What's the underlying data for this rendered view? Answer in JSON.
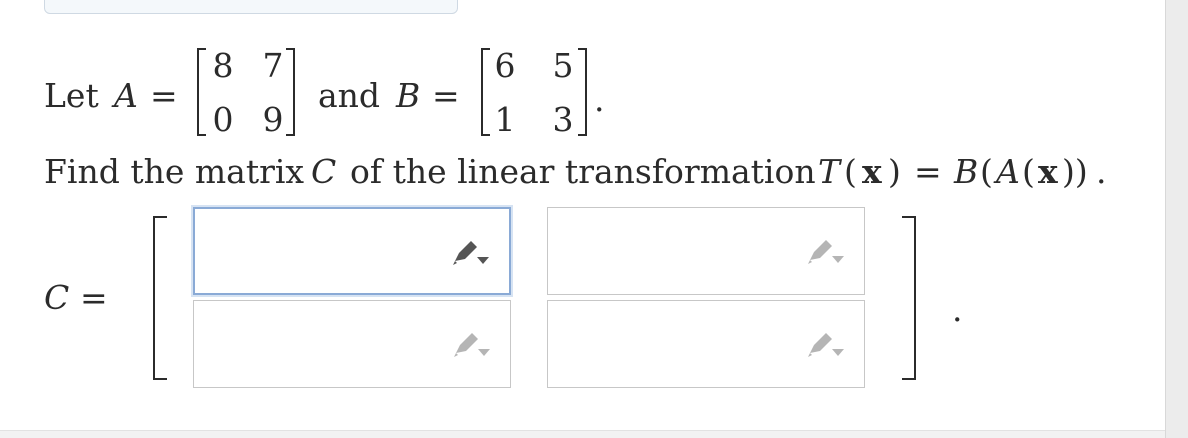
{
  "problem": {
    "let_label": "Let",
    "var_a": "A",
    "var_b": "B",
    "equals": "=",
    "and_label": "and",
    "period": ".",
    "matrix_a": {
      "r1c1": "8",
      "r1c2": "7",
      "r2c1": "0",
      "r2c2": "9"
    },
    "matrix_b": {
      "r1c1": "6",
      "r1c2": "5",
      "r2c1": "1",
      "r2c2": "3"
    },
    "find_text": "Find the matrix",
    "var_c": "C",
    "of_text": "of the linear transformation",
    "transformation": {
      "t": "T",
      "open_paren": "(",
      "x": "x",
      "close_paren": ")",
      "rhs_b": "B",
      "rhs_open": "(",
      "rhs_a": "A",
      "rhs_close": "))",
      "end_period": "."
    }
  },
  "answer": {
    "label_c": "C",
    "equals": "=",
    "trailing_period": ".",
    "cells": [
      {
        "id": "c11",
        "value": "",
        "focused": true
      },
      {
        "id": "c12",
        "value": "",
        "focused": false
      },
      {
        "id": "c21",
        "value": "",
        "focused": false
      },
      {
        "id": "c22",
        "value": "",
        "focused": false
      }
    ]
  },
  "icons": {
    "edit": "pencil-dropdown-icon"
  },
  "colors": {
    "text": "#2b2b2b",
    "focus_border": "#8aaad6",
    "cell_border": "#c7c7c7",
    "pencil_active": "#555555",
    "pencil_inactive": "#b5b5b5"
  }
}
